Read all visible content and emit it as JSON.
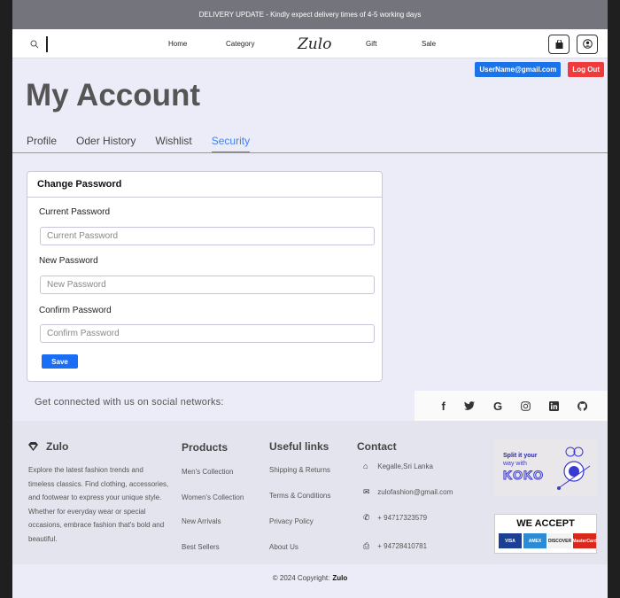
{
  "announcement": "DELIVERY UPDATE - Kindly expect delivery times of 4-5 working days",
  "nav": {
    "links": [
      "Home",
      "Category",
      "Gift",
      "Sale"
    ],
    "logo": "Zulo",
    "search_icon": "search-icon",
    "cart_icon": "shopping-bag-icon",
    "profile_icon": "user-circle-icon"
  },
  "account": {
    "email": "UserName@gmail.com",
    "logout_label": "Log Out"
  },
  "page_title": "My Account",
  "tabs": [
    "Profile",
    "Oder History",
    "Wishlist",
    "Security"
  ],
  "active_tab": "Security",
  "change_password": {
    "title": "Change Password",
    "fields": [
      {
        "label": "Current Password",
        "placeholder": "Current Password",
        "value": ""
      },
      {
        "label": "New Password",
        "placeholder": "New Password",
        "value": ""
      },
      {
        "label": "Confirm Password",
        "placeholder": "Confirm Password",
        "value": ""
      }
    ],
    "save_label": "Save"
  },
  "social": {
    "text": "Get connected with us on social networks:",
    "icons": [
      "facebook-icon",
      "twitter-icon",
      "google-icon",
      "instagram-icon",
      "linkedin-icon",
      "github-icon"
    ]
  },
  "footer": {
    "brand": "Zulo",
    "about": "Explore the latest fashion trends and timeless classics. Find clothing, accessories, and footwear to express your unique style. Whether for everyday wear or special occasions, embrace fashion that's bold and beautiful.",
    "products_title": "Products",
    "products": [
      "Men's Collection",
      "Women's Collection",
      "New Arrivals",
      "Best Sellers"
    ],
    "links_title": "Useful links",
    "links": [
      "Shipping & Returns",
      "Terms & Conditions",
      "Privacy Policy",
      "About Us"
    ],
    "contact_title": "Contact",
    "contact": [
      {
        "icon": "home-icon",
        "text": "Kegalle,Sri Lanka"
      },
      {
        "icon": "envelope-icon",
        "text": "zulofashion@gmail.com"
      },
      {
        "icon": "phone-icon",
        "text": "+ 94717323579"
      },
      {
        "icon": "printer-icon",
        "text": "+ 94728410781"
      }
    ],
    "koko": {
      "line1": "Split it your",
      "line2": "way with",
      "brand": "KOKO"
    },
    "accept": {
      "title": "WE ACCEPT",
      "cards": [
        "VISA",
        "AMEX",
        "DISCOVER",
        "MasterCard"
      ]
    }
  },
  "copyright": {
    "text": "© 2024 Copyright:",
    "brand": "Zulo"
  },
  "colors": {
    "primary": "#1a6ef5",
    "danger": "#ef3b3b",
    "active_tab": "#3b82f6",
    "announce_bg": "#74747c",
    "page_bg": "#ececf8"
  }
}
